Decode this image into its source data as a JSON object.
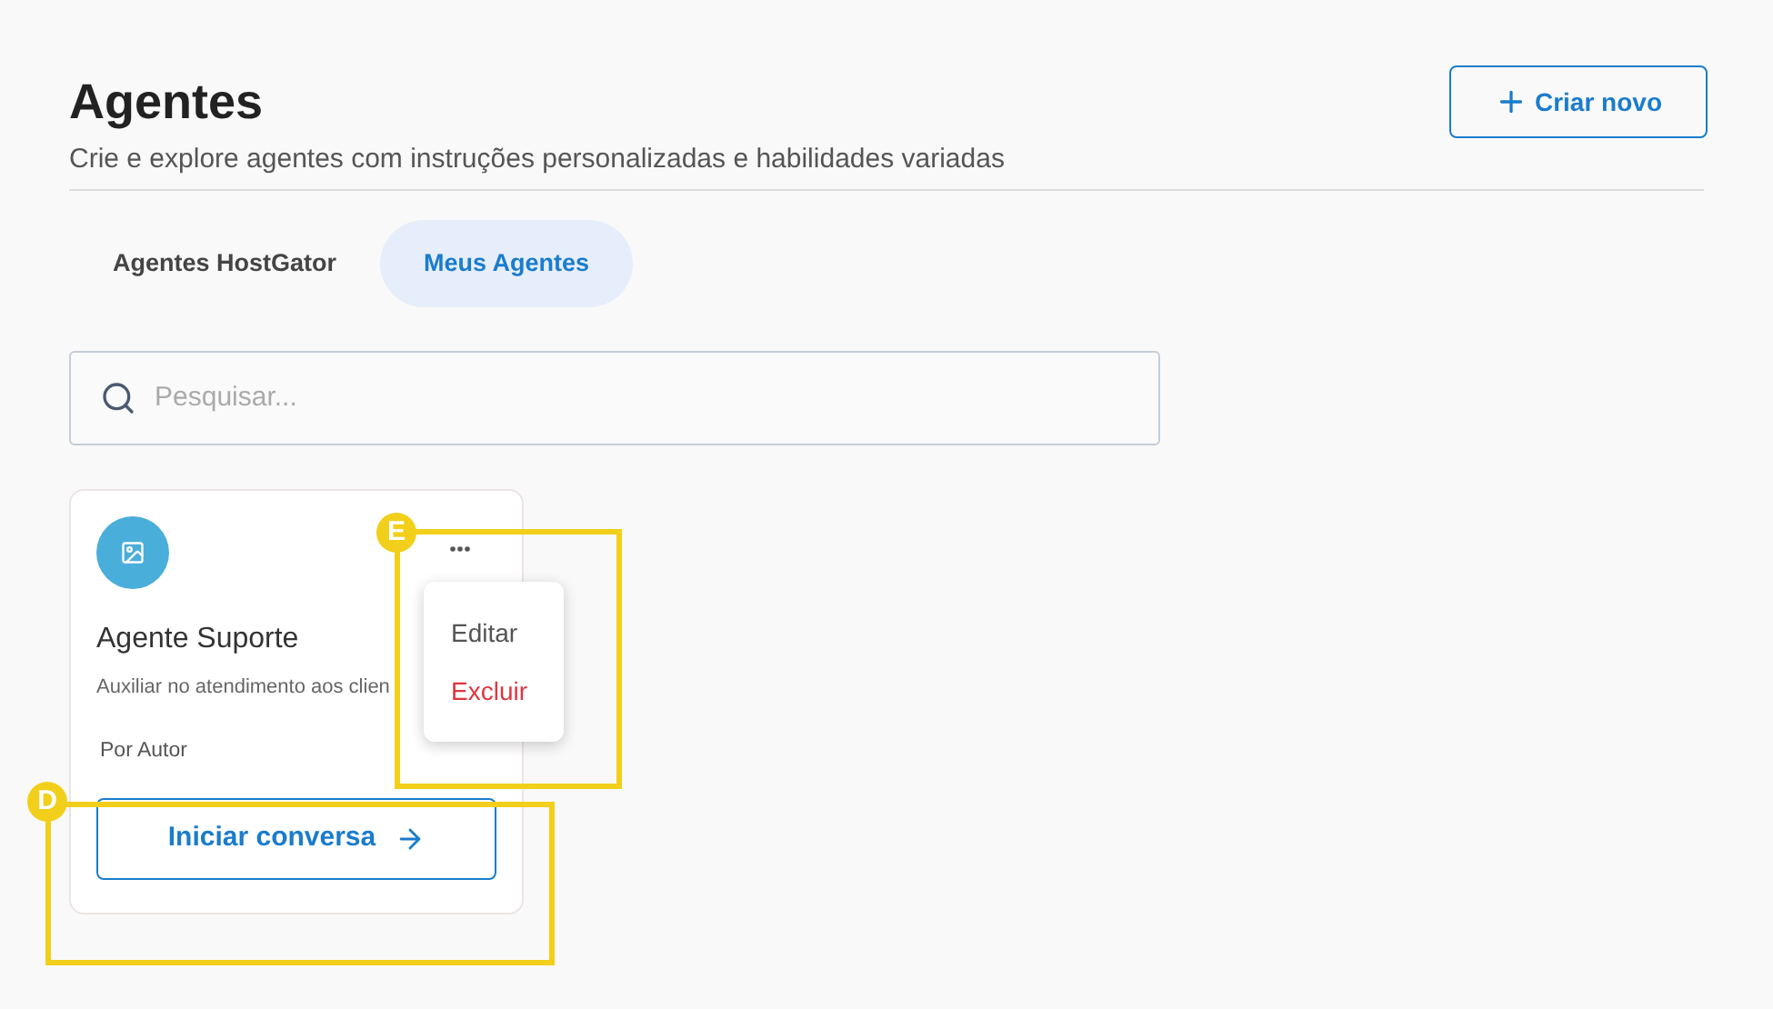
{
  "header": {
    "title": "Agentes",
    "subtitle": "Crie e explore agentes com instruções personalizadas e habilidades variadas",
    "create_button": "Criar novo"
  },
  "tabs": [
    {
      "label": "Agentes HostGator",
      "selected": false
    },
    {
      "label": "Meus Agentes",
      "selected": true
    }
  ],
  "search": {
    "placeholder": "Pesquisar..."
  },
  "cards": [
    {
      "name": "Agente Suporte",
      "description": "Auxiliar no atendimento aos clien",
      "author": "Por Autor",
      "button": "Iniciar conversa",
      "menu_open": true,
      "menu": [
        {
          "label": "Editar",
          "kind": "normal"
        },
        {
          "label": "Excluir",
          "kind": "danger"
        }
      ]
    }
  ],
  "annotations": [
    {
      "label": "E"
    },
    {
      "label": "D"
    }
  ]
}
